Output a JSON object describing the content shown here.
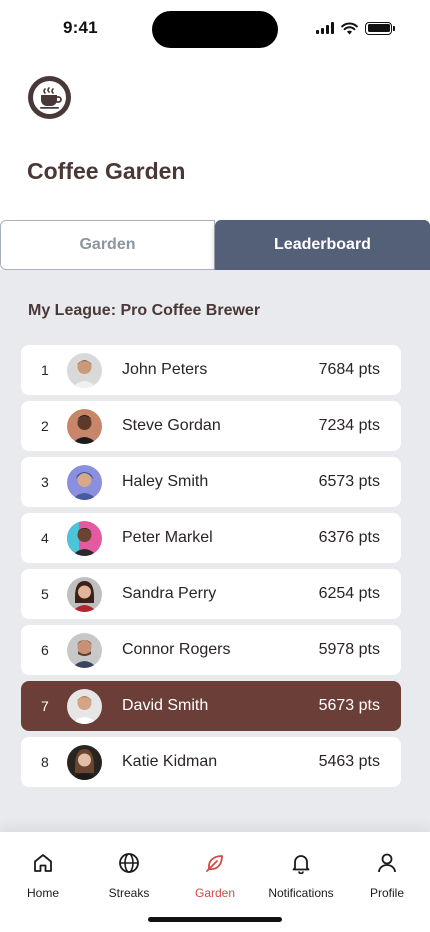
{
  "status_bar": {
    "time": "9:41"
  },
  "header": {
    "title": "Coffee Garden",
    "logo_icon": "coffee-cup-icon"
  },
  "tabs": [
    {
      "label": "Garden",
      "active": false
    },
    {
      "label": "Leaderboard",
      "active": true
    }
  ],
  "league": {
    "title": "My League: Pro Coffee Brewer"
  },
  "leaderboard": [
    {
      "rank": "1",
      "name": "John Peters",
      "points": "7684 pts",
      "highlight": false
    },
    {
      "rank": "2",
      "name": "Steve Gordan",
      "points": "7234 pts",
      "highlight": false
    },
    {
      "rank": "3",
      "name": "Haley Smith",
      "points": "6573 pts",
      "highlight": false
    },
    {
      "rank": "4",
      "name": "Peter Markel",
      "points": "6376 pts",
      "highlight": false
    },
    {
      "rank": "5",
      "name": "Sandra Perry",
      "points": "6254 pts",
      "highlight": false
    },
    {
      "rank": "6",
      "name": "Connor Rogers",
      "points": "5978 pts",
      "highlight": false
    },
    {
      "rank": "7",
      "name": "David Smith",
      "points": "5673 pts",
      "highlight": true
    },
    {
      "rank": "8",
      "name": "Katie Kidman",
      "points": "5463 pts",
      "highlight": false
    }
  ],
  "bottom_nav": [
    {
      "label": "Home",
      "icon": "home-icon",
      "active": false
    },
    {
      "label": "Streaks",
      "icon": "globe-icon",
      "active": false
    },
    {
      "label": "Garden",
      "icon": "leaf-icon",
      "active": true
    },
    {
      "label": "Notifications",
      "icon": "bell-icon",
      "active": false
    },
    {
      "label": "Profile",
      "icon": "user-icon",
      "active": false
    }
  ],
  "colors": {
    "brand_brown": "#4a3838",
    "highlight_row": "#6b3f38",
    "tab_active": "#545f78",
    "content_bg": "#e8eaed",
    "nav_active": "#d24a4a"
  }
}
